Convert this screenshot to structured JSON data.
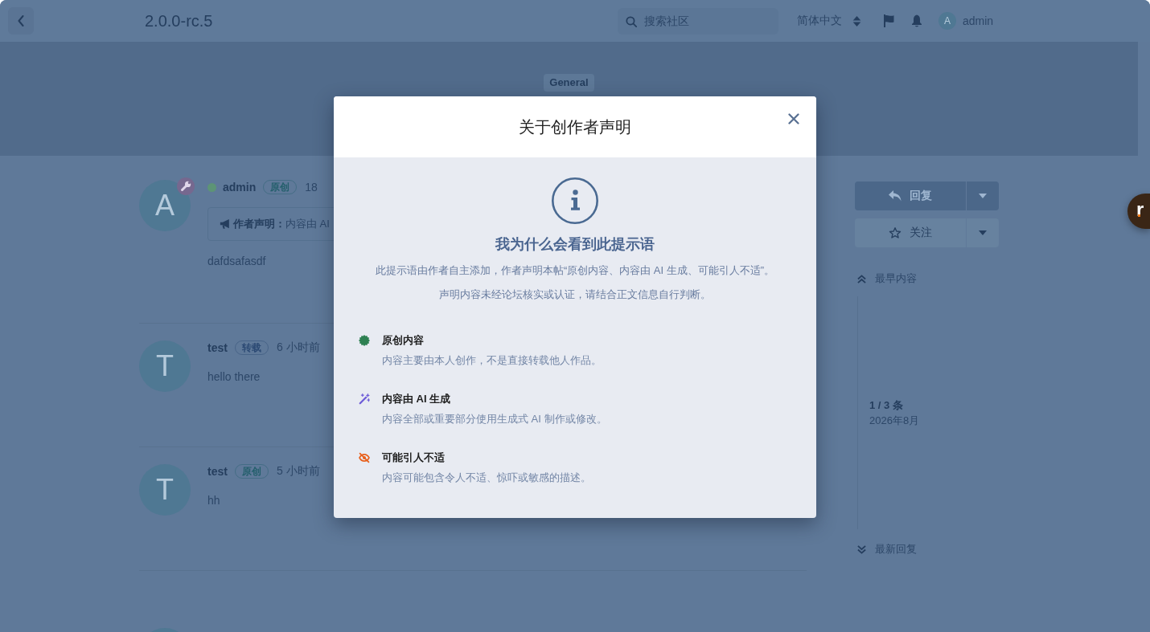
{
  "topbar": {
    "title": "2.0.0-rc.5",
    "search": {
      "placeholder": "搜索社区"
    },
    "language": "简体中文",
    "user": {
      "avatar_letter": "A",
      "name": "admin"
    }
  },
  "hero": {
    "tag": "General"
  },
  "posts": [
    {
      "avatar_letter": "A",
      "admin_badge": true,
      "online": true,
      "author": "admin",
      "tag": {
        "label": "原创",
        "color": "#245f6c"
      },
      "time": "18",
      "notice": "**作者声明：**内容由 AI",
      "body": "dafdsafasdf"
    },
    {
      "avatar_letter": "T",
      "admin_badge": false,
      "online": false,
      "author": "test",
      "tag": {
        "label": "转载",
        "color": "#2c4a74"
      },
      "time": "6 小时前",
      "body": "hello there"
    },
    {
      "avatar_letter": "T",
      "admin_badge": false,
      "online": false,
      "author": "test",
      "tag": {
        "label": "原创",
        "color": "#245f6c"
      },
      "time": "5 小时前",
      "body": "hh"
    }
  ],
  "next_post_peek": true,
  "actions": {
    "reply": "回复",
    "follow": "关注"
  },
  "scrubber": {
    "first": "最早内容",
    "position": "1 / 3 条",
    "date": "2026年8月",
    "last": "最新回复"
  },
  "floating_button": {
    "label": "r"
  },
  "modal": {
    "title": "关于创作者声明",
    "heading": "我为什么会看到此提示语",
    "paragraphs": [
      "此提示语由作者自主添加，作者声明本帖“原创内容、内容由 AI 生成、可能引人不适”。",
      "声明内容未经论坛核实或认证，请结合正文信息自行判断。"
    ],
    "items": [
      {
        "kind": "original",
        "color": "#2e8052",
        "title": "原创内容",
        "description": "内容主要由本人创作，不是直接转载他人作品。"
      },
      {
        "kind": "generated",
        "color": "#6d5bd8",
        "title": "内容由 AI 生成",
        "description": "内容全部或重要部分使用生成式 AI 制作或修改。"
      },
      {
        "kind": "sensitive",
        "color": "#e8601c",
        "title": "可能引人不适",
        "description": "内容可能包含令人不适、惊吓或敏感的描述。"
      }
    ]
  }
}
